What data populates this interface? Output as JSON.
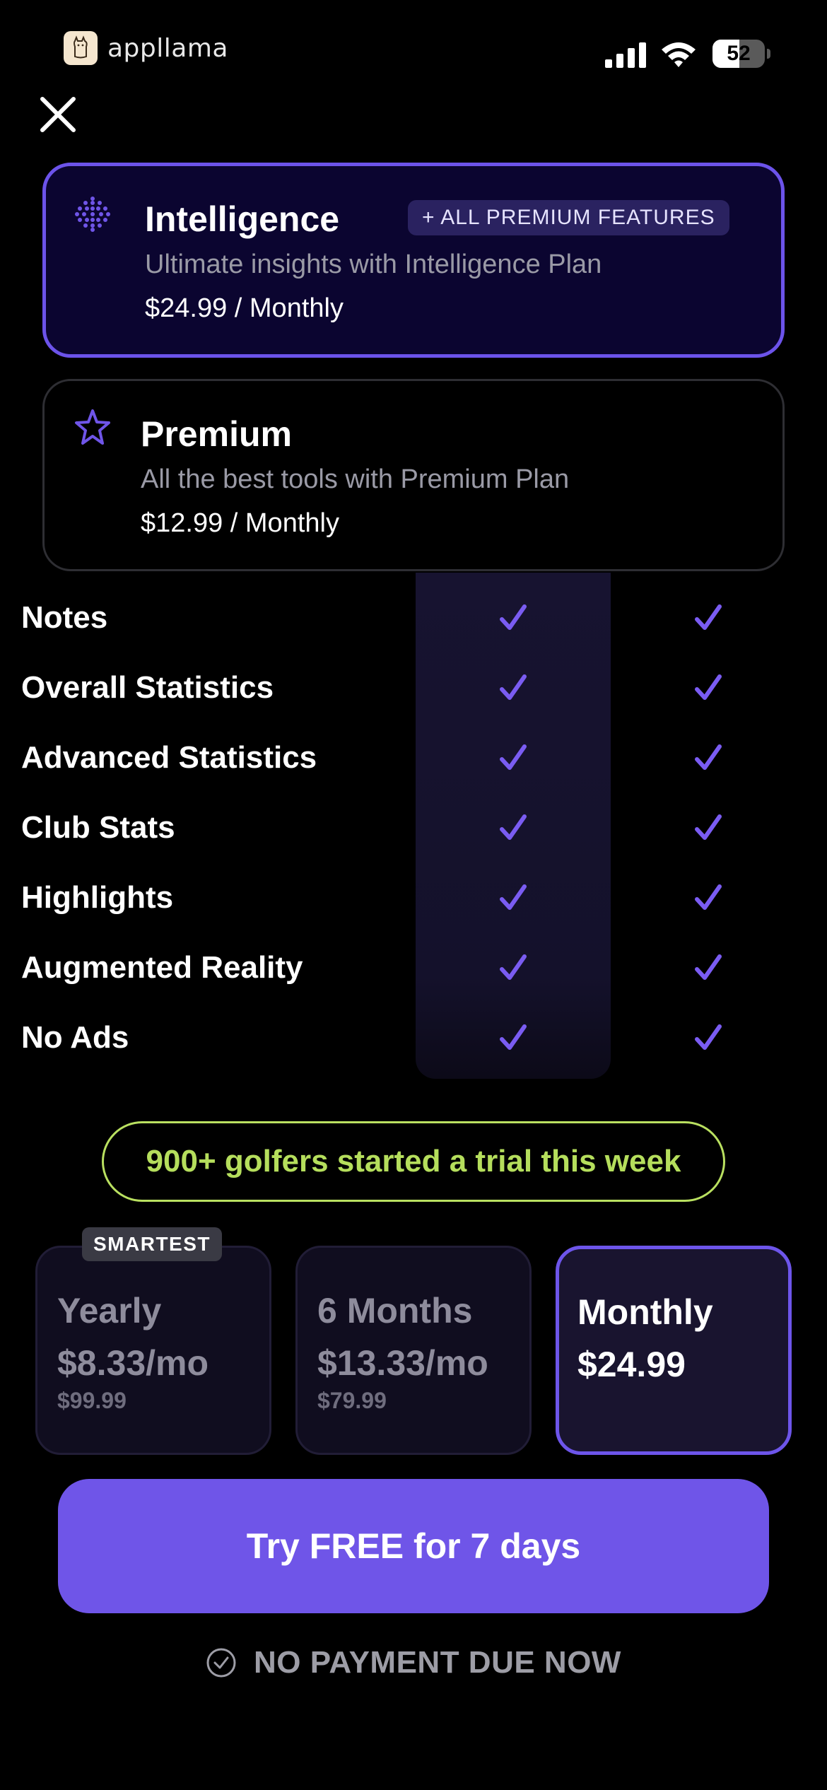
{
  "status_bar": {
    "brand_name": "appllama",
    "battery_level": "52",
    "battery_fraction": 0.52
  },
  "plans": {
    "intelligence": {
      "name": "Intelligence",
      "badge": "+ ALL PREMIUM FEATURES",
      "subtitle": "Ultimate insights with Intelligence Plan",
      "price": "$24.99 / Monthly"
    },
    "premium": {
      "name": "Premium",
      "subtitle": "All the best tools with Premium Plan",
      "price": "$12.99 / Monthly"
    }
  },
  "features": [
    {
      "name": "Notes",
      "intelligence": true,
      "premium": true
    },
    {
      "name": "Overall Statistics",
      "intelligence": true,
      "premium": true
    },
    {
      "name": "Advanced Statistics",
      "intelligence": true,
      "premium": true
    },
    {
      "name": "Club Stats",
      "intelligence": true,
      "premium": true
    },
    {
      "name": "Highlights",
      "intelligence": true,
      "premium": true
    },
    {
      "name": "Augmented Reality",
      "intelligence": true,
      "premium": true
    },
    {
      "name": "No Ads",
      "intelligence": true,
      "premium": true
    }
  ],
  "social_proof": "900+ golfers started a trial this week",
  "pricing": {
    "smartest_badge": "SMARTEST",
    "options": [
      {
        "period": "Yearly",
        "price": "$8.33/mo",
        "total": "$99.99",
        "selected": false
      },
      {
        "period": "6 Months",
        "price": "$13.33/mo",
        "total": "$79.99",
        "selected": false
      },
      {
        "period": "Monthly",
        "price": "$24.99",
        "total": "",
        "selected": true
      }
    ]
  },
  "cta_label": "Try FREE for 7 days",
  "no_payment_text": "NO PAYMENT DUE NOW",
  "colors": {
    "accent": "#6f55e8",
    "check": "#7a5cf2",
    "social_green": "#b5de5c",
    "intel_card_bg": "#0b0530"
  }
}
